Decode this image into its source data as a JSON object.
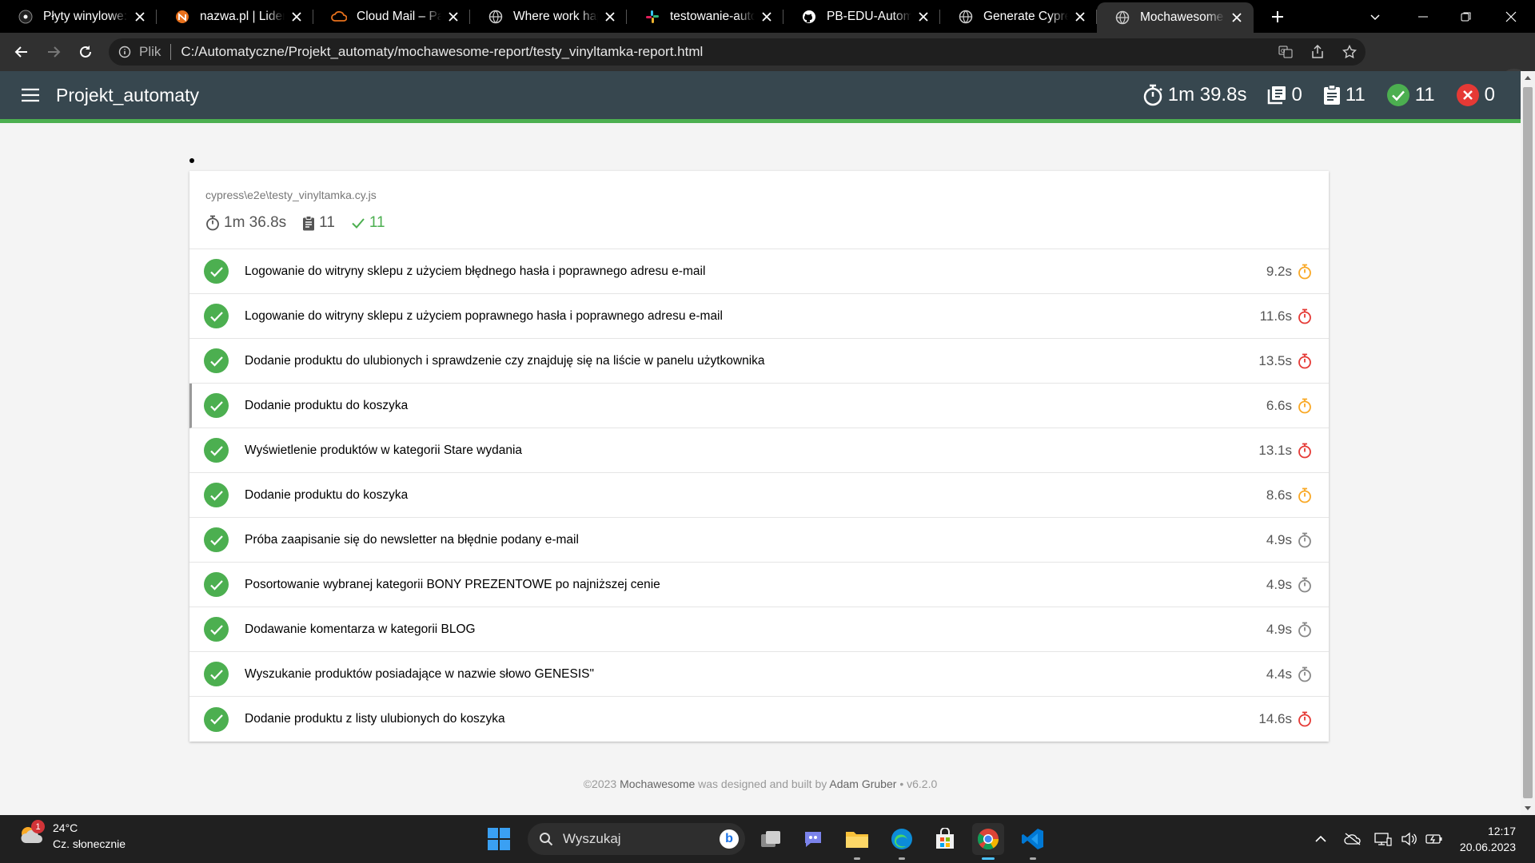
{
  "browser": {
    "tabs": [
      {
        "title": "Płyty winylowe: u",
        "icon": "vinyl-record-icon",
        "active": false
      },
      {
        "title": "nazwa.pl | Lider h",
        "icon": "nazwa-icon",
        "active": false
      },
      {
        "title": "Cloud Mail – Pan",
        "icon": "cloud-mail-icon",
        "active": false
      },
      {
        "title": "Where work happ",
        "icon": "globe-icon",
        "active": false
      },
      {
        "title": "testowanie-autom",
        "icon": "slack-icon",
        "active": false
      },
      {
        "title": "PB-EDU-Automat",
        "icon": "github-icon",
        "active": false
      },
      {
        "title": "Generate Cypress",
        "icon": "globe-icon",
        "active": false
      },
      {
        "title": "Mochawesome Re",
        "icon": "globe-icon",
        "active": true
      }
    ],
    "address": {
      "scheme_label": "Plik",
      "url": "C:/Automatyczne/Projekt_automaty/mochawesome-report/testy_vinyltamka-report.html"
    }
  },
  "report": {
    "title": "Projekt_automaty",
    "stats": {
      "duration": "1m 39.8s",
      "suites": "0",
      "tests": "11",
      "passes": "11",
      "failures": "0"
    },
    "suite": {
      "file": "cypress\\e2e\\testy_vinyltamka.cy.js",
      "duration": "1m 36.8s",
      "tests": "11",
      "passes": "11",
      "tests_list": [
        {
          "name": "Logowanie do witryny sklepu z użyciem błędnego hasła i poprawnego adresu e-mail",
          "duration": "9.2s",
          "speed": "medium"
        },
        {
          "name": "Logowanie do witryny sklepu z użyciem poprawnego hasła i poprawnego adresu e-mail",
          "duration": "11.6s",
          "speed": "slow"
        },
        {
          "name": "Dodanie produktu do ulubionych i sprawdzenie czy znajduję się na liście w panelu użytkownika",
          "duration": "13.5s",
          "speed": "slow"
        },
        {
          "name": "Dodanie produktu do koszyka",
          "duration": "6.6s",
          "speed": "medium"
        },
        {
          "name": "Wyświetlenie produktów w kategorii Stare wydania",
          "duration": "13.1s",
          "speed": "slow"
        },
        {
          "name": "Dodanie produktu do koszyka",
          "duration": "8.6s",
          "speed": "medium"
        },
        {
          "name": "Próba zaapisanie się do newsletter na błędnie podany e-mail",
          "duration": "4.9s",
          "speed": "fast"
        },
        {
          "name": "Posortowanie wybranej kategorii BONY PREZENTOWE po najniższej cenie",
          "duration": "4.9s",
          "speed": "fast"
        },
        {
          "name": "Dodawanie komentarza w kategorii BLOG",
          "duration": "4.9s",
          "speed": "fast"
        },
        {
          "name": "Wyszukanie produktów posiadające w nazwie słowo GENESIS\"",
          "duration": "4.4s",
          "speed": "fast"
        },
        {
          "name": "Dodanie produktu z listy ulubionych do koszyka",
          "duration": "14.6s",
          "speed": "slow"
        }
      ]
    },
    "footer": {
      "copyright": "©2023",
      "mochawesome": "Mochawesome",
      "designed": "was designed and built by",
      "author": "Adam Gruber",
      "version": "• v6.2.0"
    }
  },
  "taskbar": {
    "weather": {
      "temp": "24°C",
      "desc": "Cz. słonecznie",
      "badge": "1"
    },
    "search_placeholder": "Wyszukaj",
    "time": "12:17",
    "date": "20.06.2023"
  },
  "colors": {
    "pass": "#4caf50",
    "fail": "#e53935",
    "medium": "#f9a825",
    "slow": "#e53935",
    "fast": "#888888",
    "header": "#37474f"
  }
}
